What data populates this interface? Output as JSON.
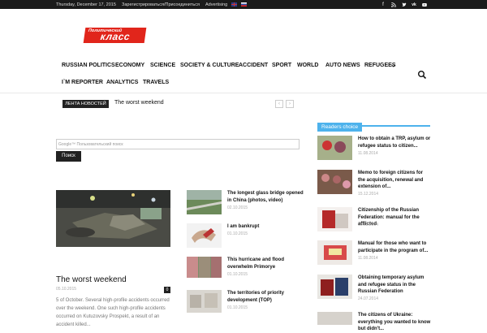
{
  "topbar": {
    "date": "Thursday, December 17, 2015",
    "register": "Зарегистрироваться/Присоединиться",
    "advertising": "Advertising"
  },
  "logo": {
    "small": "Политический",
    "big": "класс"
  },
  "nav": {
    "items": [
      "RUSSIAN POLITICS",
      "ECONOMY",
      "SCIENCE",
      "SOCIETY & CULTURE",
      "ACCIDENT",
      "SPORT",
      "WORLD",
      "AUTO NEWS",
      "REFUGEES"
    ],
    "items2": [
      "I`M REPORTER",
      "ANALYTICS",
      "TRAVELS"
    ]
  },
  "ticker": {
    "label": "ЛЕНТА НОВОСТЕЙ",
    "text": "The worst weekend",
    "prev": "‹",
    "next": "›"
  },
  "search": {
    "placeholder": "Google™ Пользовательский поиск",
    "button": "Поиск"
  },
  "main": {
    "title": "The worst weekend",
    "date": "05.10.2015",
    "comments": "0",
    "excerpt": "5 of October. Several high-profile accidents occurred over the weekend. One such high-profile accidents occurred on Kutuzovsky Prospekt, a result of an accident killed..."
  },
  "middle": [
    {
      "title": "The longest glass bridge opened in China (photos, video)",
      "date": "02.10.2015"
    },
    {
      "title": "I am bankrupt",
      "date": "01.10.2015"
    },
    {
      "title": "This hurricane and flood overwhelm Primorye",
      "date": "01.10.2015"
    },
    {
      "title": "The territories of priority development (TOP)",
      "date": "01.10.2015"
    }
  ],
  "readers": {
    "heading": "Readers   choice",
    "items": [
      {
        "title": "How to obtain a TRP, asylum or refugee status to citizen...",
        "date": "11.08.2014"
      },
      {
        "title": "Memo to foreign citizens for the acquisition, renewal and extension of...",
        "date": "15.12.2014"
      },
      {
        "title": "Citizenship of the Russian Federation: manual for the afflicted",
        "date": "15.08.2014"
      },
      {
        "title": "Manual for those who want to participate in the program of...",
        "date": "11.08.2014"
      },
      {
        "title": "Obtaining temporary asylum and refugee status in the Russian Federation",
        "date": "24.07.2014"
      },
      {
        "title": "The citizens of Ukraine: everything you wanted to know but didn't...",
        "date": ""
      }
    ]
  },
  "colors": {
    "accent": "#4db2ec",
    "logo": "#e1251b",
    "topbar": "#1b1b1b"
  }
}
